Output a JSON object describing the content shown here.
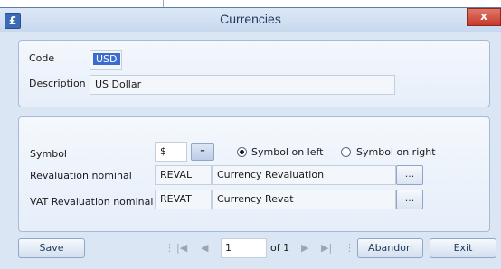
{
  "window": {
    "title": "Currencies",
    "icon": "pound-sign-icon",
    "app_icon_glyph": "£",
    "close_glyph": "x"
  },
  "details": {
    "code_label": "Code",
    "code_value": "USD",
    "description_label": "Description",
    "description_value": "US Dollar"
  },
  "options": {
    "symbol_label": "Symbol",
    "symbol_value": "$",
    "symbol_btn": "–",
    "symbol_left_label": "Symbol on left",
    "symbol_right_label": "Symbol on right",
    "symbol_position_selected": "left",
    "reval_label": "Revaluation nominal",
    "reval_code": "REVAL",
    "reval_desc": "Currency Revaluation",
    "vat_reval_label": "VAT Revaluation nominal",
    "vat_reval_code": "REVAT",
    "vat_reval_desc": "Currency Revat",
    "lookup_btn": "..."
  },
  "footer": {
    "save": "Save",
    "page_value": "1",
    "of_label": "of 1",
    "abandon": "Abandon",
    "exit": "Exit",
    "nav_first": "|◀",
    "nav_prev": "◀",
    "nav_next": "▶",
    "nav_last": "▶|",
    "separator": "⋮"
  },
  "colors": {
    "titlebar": "#c8d9ee",
    "close": "#c7392a",
    "selection": "#3b6bd0"
  }
}
